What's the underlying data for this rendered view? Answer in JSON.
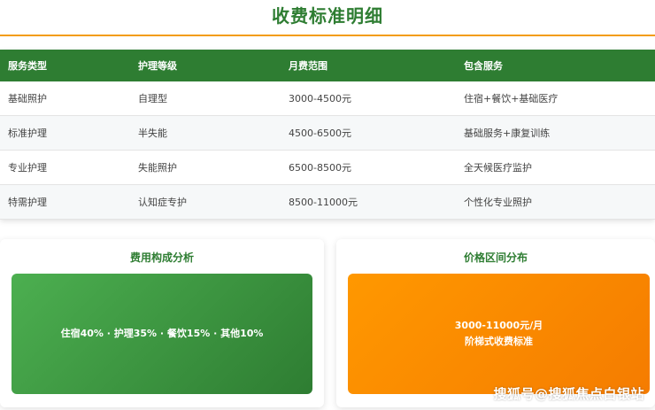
{
  "page": {
    "title": "收费标准明细",
    "accent_color": "#2e7d32",
    "rule_color": "#f39c12"
  },
  "table": {
    "headers": [
      "服务类型",
      "护理等级",
      "月费范围",
      "包含服务"
    ],
    "rows": [
      [
        "基础照护",
        "自理型",
        "3000-4500元",
        "住宿+餐饮+基础医疗"
      ],
      [
        "标准护理",
        "半失能",
        "4500-6500元",
        "基础服务+康复训练"
      ],
      [
        "专业护理",
        "失能照护",
        "6500-8500元",
        "全天候医疗监护"
      ],
      [
        "特需护理",
        "认知症专护",
        "8500-11000元",
        "个性化专业照护"
      ]
    ]
  },
  "cards": {
    "cost_breakdown": {
      "title": "费用构成分析",
      "text": "住宿40% · 护理35% · 餐饮15% · 其他10%",
      "color": "#4caf50"
    },
    "price_range": {
      "title": "价格区间分布",
      "line1": "3000-11000元/月",
      "line2": "阶梯式收费标准",
      "color": "#ff9800"
    }
  },
  "watermark": "搜狐号@搜狐焦点白银站"
}
